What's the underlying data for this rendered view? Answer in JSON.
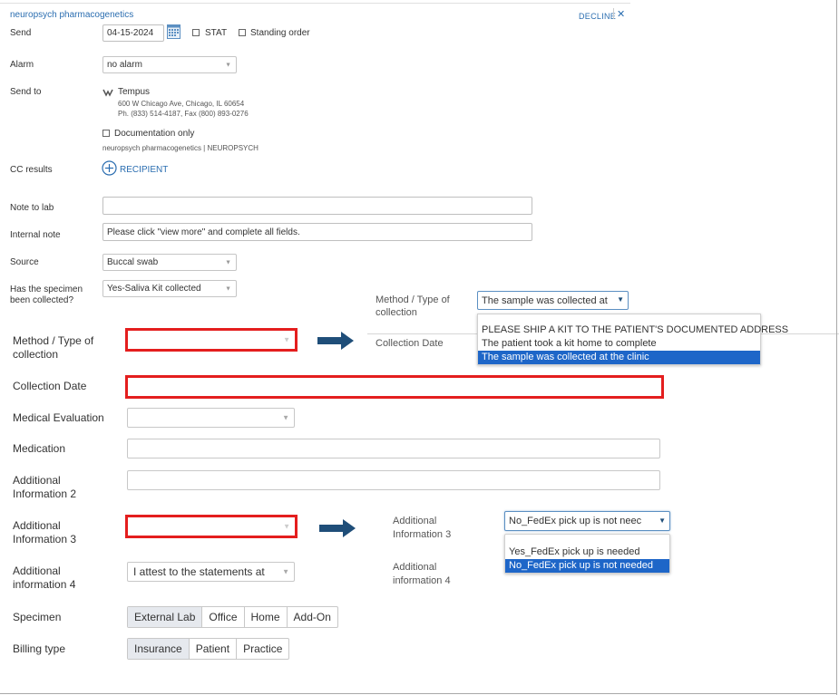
{
  "order": {
    "title": "neuropsych pharmacogenetics",
    "decline_label": "DECLINE",
    "close_glyph": "✕",
    "send_label": "Send",
    "send_date": "04-15-2024",
    "stat_label": "STAT",
    "standing_label": "Standing order",
    "alarm_label": "Alarm",
    "alarm_value": "no alarm",
    "send_to_label": "Send to",
    "lab_name": "Tempus",
    "lab_address": "600 W Chicago Ave, Chicago, IL 60654",
    "lab_phone": "Ph. (833) 514-4187, Fax (800) 893-0276",
    "documentation_only_label": "Documentation only",
    "order_sub": "neuropsych pharmacogenetics | NEUROPSYCH",
    "cc_results_label": "CC results",
    "recipient_label": "RECIPIENT",
    "note_to_lab_label": "Note to lab",
    "note_to_lab_value": "",
    "internal_note_label": "Internal note",
    "internal_note_value": "Please click \"view more\" and complete all fields.",
    "source_label": "Source",
    "source_value": "Buccal swab",
    "specimen_collected_label_1": "Has the specimen",
    "specimen_collected_label_2": "been collected?",
    "specimen_collected_value": "Yes-Saliva Kit collected"
  },
  "popup1": {
    "label_1": "Method / Type of",
    "label_2": "collection",
    "selected_value": "The sample was collected at",
    "collection_date_label": "Collection Date",
    "options": [
      "PLEASE SHIP A KIT TO THE PATIENT'S DOCUMENTED ADDRESS",
      "The patient took a kit home to complete",
      "The sample was collected at the clinic"
    ]
  },
  "form": {
    "method_label_1": "Method / Type of",
    "method_label_2": "collection",
    "collection_date_label": "Collection Date",
    "medical_eval_label": "Medical Evaluation",
    "medication_label": "Medication",
    "add_info2_label_1": "Additional",
    "add_info2_label_2": "Information 2",
    "add_info3_label_1": "Additional",
    "add_info3_label_2": "Information 3",
    "add_info4_label_1": "Additional",
    "add_info4_label_2": "information 4",
    "add_info4_value": "I attest to the statements at",
    "specimen_label": "Specimen",
    "specimen_options": [
      "External Lab",
      "Office",
      "Home",
      "Add-On"
    ],
    "billing_label": "Billing type",
    "billing_options": [
      "Insurance",
      "Patient",
      "Practice"
    ]
  },
  "popup2": {
    "label3_1": "Additional",
    "label3_2": "Information 3",
    "label4_1": "Additional",
    "label4_2": "information 4",
    "selected_value": "No_FedEx pick up is not neec",
    "options": [
      "Yes_FedEx pick up is needed",
      "No_FedEx pick up is not needed"
    ]
  },
  "colors": {
    "highlight_red": "#e41e1e",
    "arrow_navy": "#1f4e79",
    "selection_blue": "#1e66c8",
    "link_blue": "#2a6db0"
  }
}
